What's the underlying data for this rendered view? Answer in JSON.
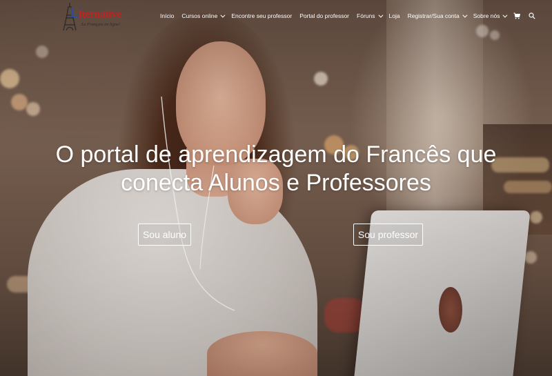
{
  "brand": {
    "logo_l": "L'",
    "logo_rest": "lternative",
    "tagline": "Le Français en ligne!"
  },
  "nav": {
    "items": [
      {
        "label": "Início",
        "has_dropdown": false
      },
      {
        "label": "Cursos online",
        "has_dropdown": true
      },
      {
        "label": "Encontre seu professor",
        "has_dropdown": false
      },
      {
        "label": "Portal do professor",
        "has_dropdown": false
      },
      {
        "label": "Fóruns",
        "has_dropdown": true
      },
      {
        "label": "Loja",
        "has_dropdown": false
      },
      {
        "label": "Registrar/Sua conta",
        "has_dropdown": true
      },
      {
        "label": "Sobre nós",
        "has_dropdown": true
      }
    ],
    "cart_icon": "cart-icon",
    "search_icon": "search-icon"
  },
  "hero": {
    "headline_line1": "O portal de aprendizagem do Francês que",
    "headline_line2": "conecta Alunos e Professores",
    "cta_student": "Sou aluno",
    "cta_teacher": "Sou professor"
  },
  "colors": {
    "nav_text": "#ffffff",
    "logo_blue": "#2a4d9c",
    "logo_red": "#c4221f",
    "cta_border": "#ffffff"
  }
}
